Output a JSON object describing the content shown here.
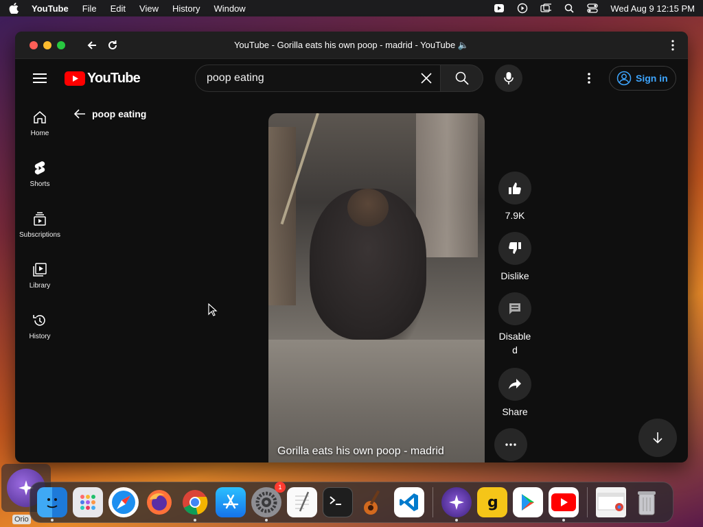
{
  "menubar": {
    "app_name": "YouTube",
    "items": [
      "File",
      "Edit",
      "View",
      "History",
      "Window"
    ],
    "datetime": "Wed Aug 9  12:15 PM"
  },
  "browser": {
    "title": "YouTube - Gorilla eats his own poop - madrid - YouTube 🔈"
  },
  "youtube": {
    "logo_text": "YouTube",
    "search": {
      "value": "poop eating",
      "placeholder": "Search"
    },
    "signin_label": "Sign in",
    "guide": [
      {
        "label": "Home",
        "icon": "home-icon"
      },
      {
        "label": "Shorts",
        "icon": "shorts-icon"
      },
      {
        "label": "Subscriptions",
        "icon": "subscriptions-icon"
      },
      {
        "label": "Library",
        "icon": "library-icon"
      },
      {
        "label": "History",
        "icon": "history-icon"
      }
    ],
    "query_label": "poop eating",
    "short": {
      "title": "Gorilla eats his own poop - madrid",
      "like_count": "7.9K",
      "dislike_label": "Dislike",
      "comments_label": "Disable\nd",
      "share_label": "Share"
    }
  },
  "dock": {
    "apps": [
      "finder",
      "launchpad",
      "safari",
      "firefox",
      "chrome",
      "app-store",
      "system-settings",
      "textedit",
      "terminal",
      "garageband",
      "vscode",
      "orion",
      "grammarly",
      "google-play",
      "youtube",
      "chrome-window",
      "trash"
    ],
    "settings_badge": "1"
  },
  "orion_label": "Orio",
  "colors": {
    "accent": "#3ea6ff",
    "youtube_red": "#ff0000",
    "bg": "#0f0f0f"
  }
}
